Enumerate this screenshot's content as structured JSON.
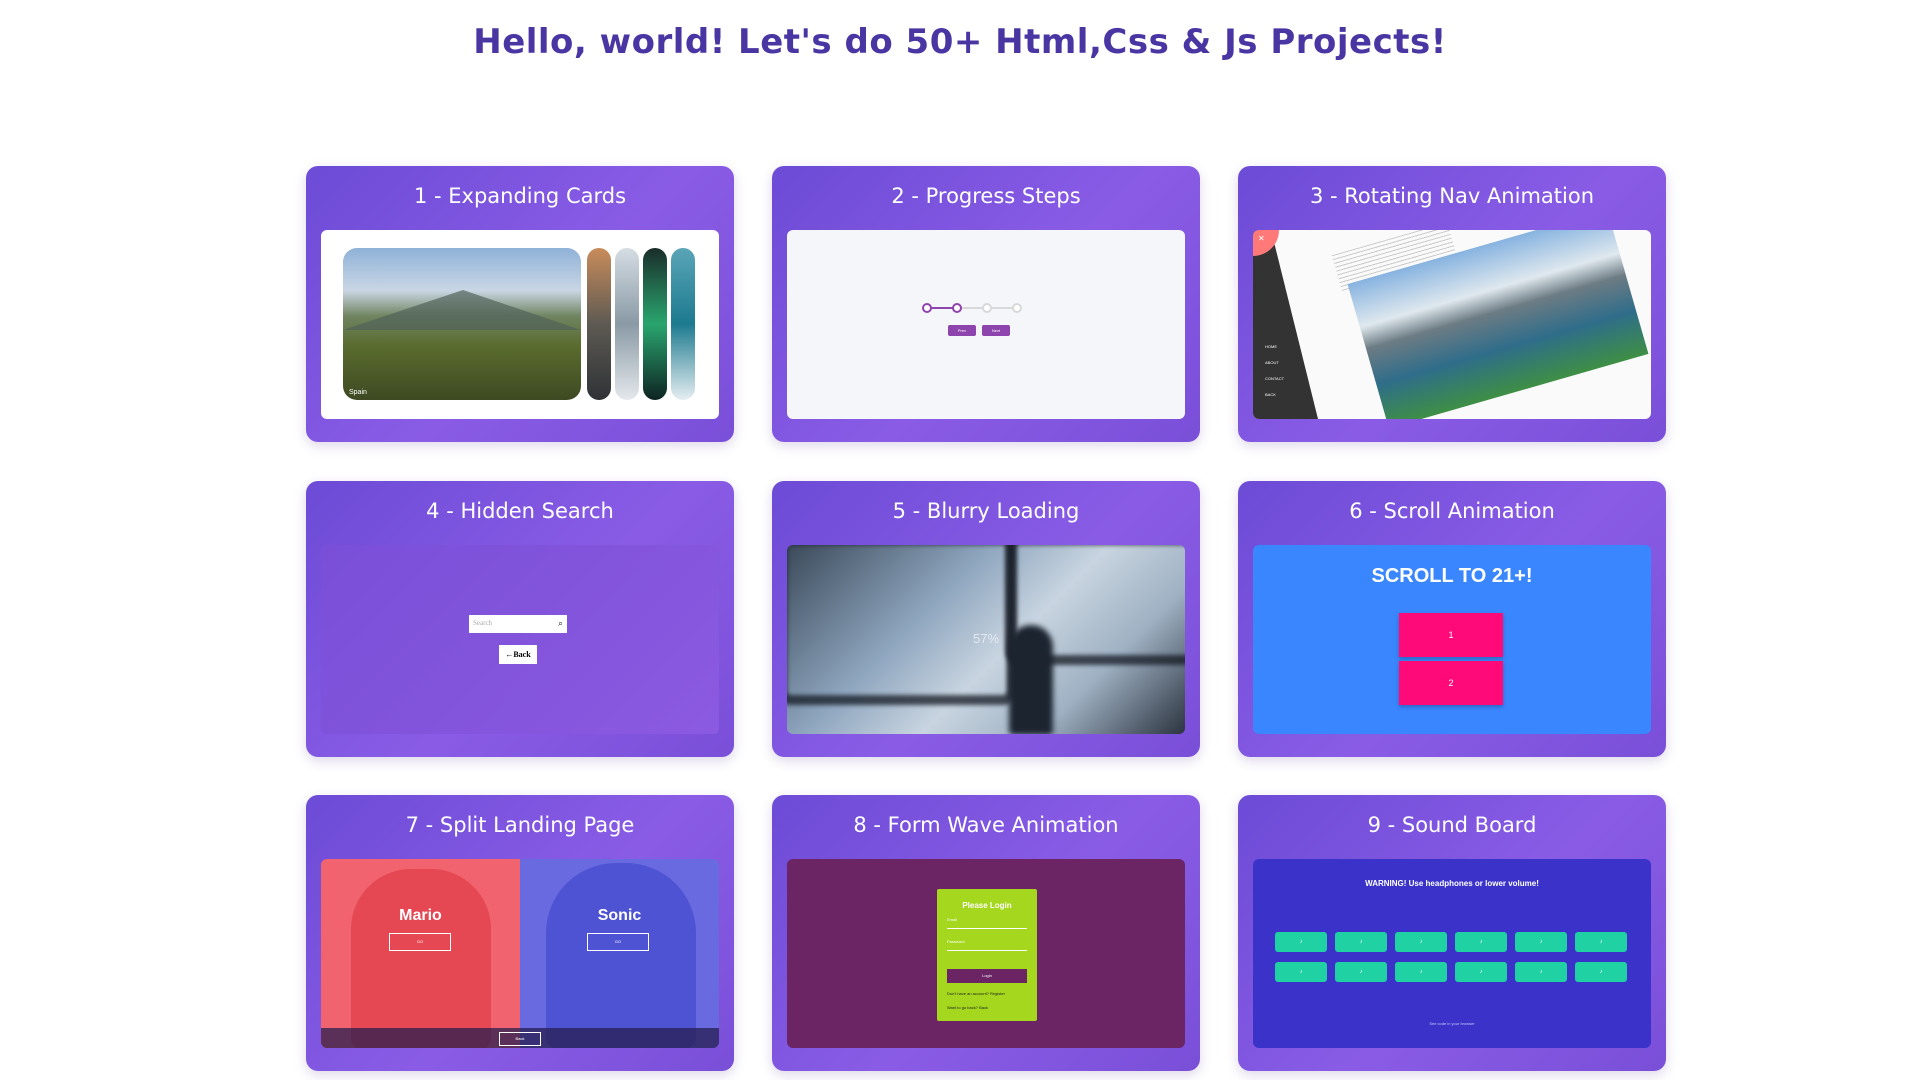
{
  "page": {
    "title": "Hello, world! Let's do 50+ Html,Css & Js Projects!"
  },
  "colors": {
    "title": "#4a36a3",
    "card_gradient_start": "#6c4bd6",
    "card_gradient_end": "#8a5ce6"
  },
  "projects": [
    {
      "title": "1 - Expanding Cards",
      "preview": {
        "caption": "Spain"
      }
    },
    {
      "title": "2 - Progress Steps",
      "preview": {
        "prev_label": "Prev",
        "next_label": "Next"
      }
    },
    {
      "title": "3 - Rotating Nav Animation",
      "preview": {
        "nav_items": [
          "HOME",
          "ABOUT",
          "CONTACT",
          "BACK"
        ],
        "close_icon": "close-icon"
      }
    },
    {
      "title": "4 - Hidden Search",
      "preview": {
        "search_placeholder": "Search",
        "back_label": "←Back"
      }
    },
    {
      "title": "5 - Blurry Loading",
      "preview": {
        "loading_text": "57%"
      }
    },
    {
      "title": "6 - Scroll Animation",
      "preview": {
        "heading": "SCROLL TO 21+!",
        "boxes": [
          "1",
          "2"
        ]
      }
    },
    {
      "title": "7 - Split Landing Page",
      "preview": {
        "left_name": "Mario",
        "right_name": "Sonic",
        "left_button": "GO",
        "right_button": "GO",
        "back_label": "Back"
      }
    },
    {
      "title": "8 - Form Wave Animation",
      "preview": {
        "heading": "Please Login",
        "email_label": "Email",
        "password_label": "Password",
        "login_label": "Login",
        "register_text": "Don't have an account? Register",
        "back_text": "Want to go back? Back"
      }
    },
    {
      "title": "9 - Sound Board",
      "preview": {
        "warning": "WARNING! Use headphones or lower volume!",
        "buttons_row1": [
          "♪",
          "♪",
          "♪",
          "♪",
          "♪",
          "♪"
        ],
        "buttons_row2": [
          "♪",
          "♪",
          "♪",
          "♪",
          "♪",
          "♪"
        ],
        "footer": "See code in your browser"
      }
    }
  ]
}
